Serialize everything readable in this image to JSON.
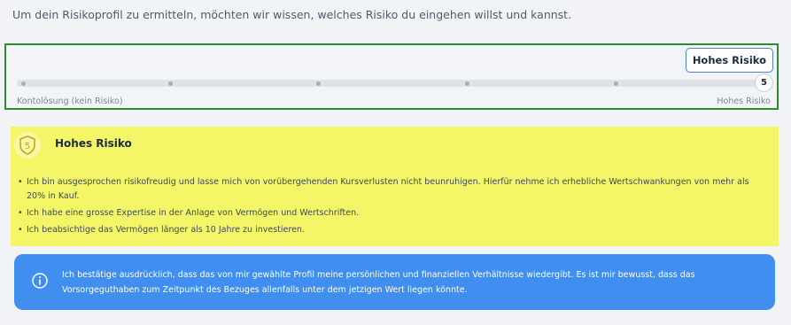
{
  "intro": "Um dein Risikoprofil zu ermitteln, möchten wir wissen, welches Risiko du eingehen willst und kannst.",
  "slider": {
    "tooltip": "Hohes Risiko",
    "value": "5",
    "min": 1,
    "max": 5,
    "min_label": "Kontolösung (kein Risiko)",
    "max_label": "Hohes Risiko",
    "accent": "#2e8b2e"
  },
  "profile": {
    "badge_value": "5",
    "title": "Hohes Risiko",
    "bullets": [
      "Ich bin ausgesprochen risikofreudig und lasse mich von vorübergehenden Kursverlusten nicht beunruhigen. Hierfür nehme ich erhebliche Wertschwankungen von mehr als 20% in Kauf.",
      "Ich habe eine grosse Expertise in der Anlage von Vermögen und Wertschriften.",
      "Ich beabsichtige das Vermögen länger als 10 Jahre zu investieren."
    ],
    "background": "#f4f667"
  },
  "info": {
    "icon": "info-icon",
    "text": "Ich bestätige ausdrücklich, dass das von mir gewählte Profil meine persönlichen und finanziellen Verhältnisse wiedergibt. Es ist mir bewusst, dass das Vorsorgeguthaben zum Zeitpunkt des Bezuges allenfalls unter dem jetzigen Wert liegen könnte.",
    "background": "#3f8ef0"
  }
}
